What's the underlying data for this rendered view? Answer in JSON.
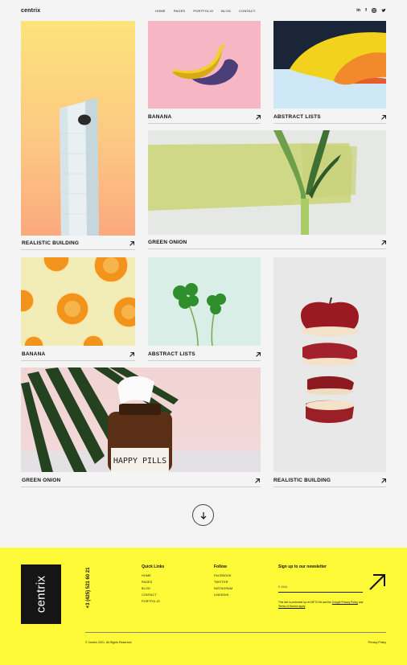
{
  "header": {
    "logo": "centrix",
    "nav": [
      "HOME",
      "PAGES",
      "PORTFOLIO",
      "BLOG",
      "CONTACT"
    ],
    "social": [
      "linkedin-icon",
      "facebook-icon",
      "instagram-icon",
      "twitter-icon"
    ]
  },
  "gallery": [
    {
      "id": "building",
      "caption": "REALISTIC BUILDING",
      "bg": "#f9c98a"
    },
    {
      "id": "banana",
      "caption": "BANANA",
      "bg": "#f6b6c4"
    },
    {
      "id": "abstract",
      "caption": "ABSTRACT LISTS",
      "bg": "#cfe8f8"
    },
    {
      "id": "onion-wide",
      "caption": "GREEN ONION",
      "bg": "#e4e6e2"
    },
    {
      "id": "oranges",
      "caption": "BANANA",
      "bg": "#f2edb6"
    },
    {
      "id": "clover",
      "caption": "ABSTRACT LISTS",
      "bg": "#d7eee6"
    },
    {
      "id": "apple",
      "caption": "REALISTIC BUILDING",
      "bg": "#e7e7e7"
    },
    {
      "id": "pills",
      "caption": "GREEN ONION",
      "bg": "#f2d8d8"
    }
  ],
  "pill_label": "HAPPY PILLS",
  "footer": {
    "logo": "centrix",
    "phone": "+3 (425) 521 60 21",
    "quick_links_title": "Quick Links",
    "quick_links": [
      "HOME",
      "PAGES",
      "BLOG",
      "CONTACT",
      "PORTFOLIO"
    ],
    "follow_title": "Follow",
    "follow_links": [
      "FACEBOOK",
      "TWITTER",
      "INSTAGRAM",
      "LINKEDIN"
    ],
    "newsletter_title": "Sign up to our newsletter",
    "email_placeholder": "E-MAIL",
    "recaptcha_text": "This site is protected by reCAPTCHA and the",
    "recaptcha_link1": "Google Privacy Policy",
    "recaptcha_and": "and",
    "recaptcha_link2": "Terms of Service apply",
    "copyright": "© Centrix 2021. All Rights Reserved.",
    "privacy": "Privacy Policy"
  }
}
